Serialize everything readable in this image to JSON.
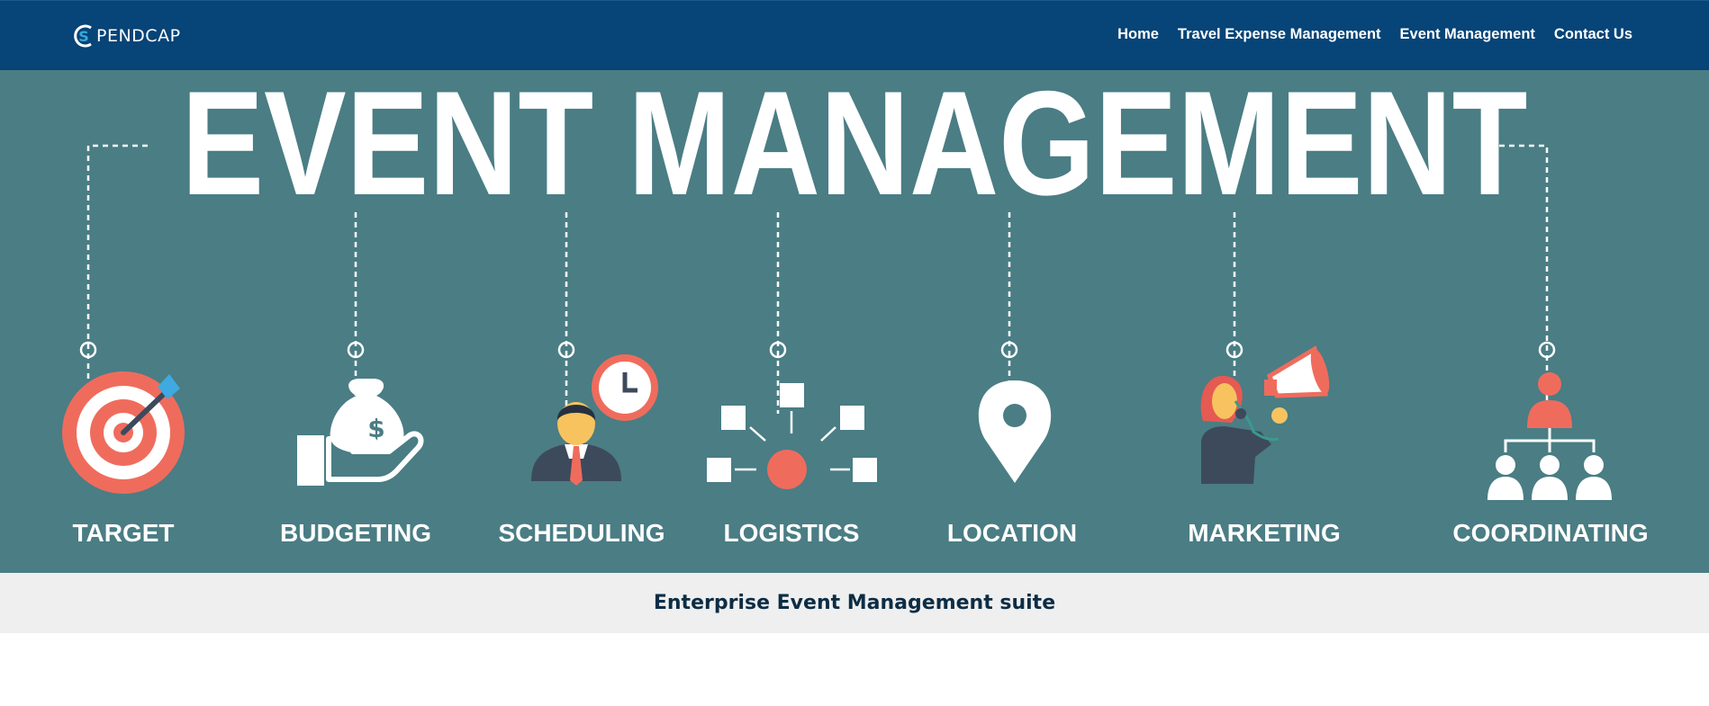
{
  "brand": {
    "logo_text": "PENDCAP",
    "logo_letter": "S"
  },
  "nav": {
    "items": [
      {
        "label": "Home"
      },
      {
        "label": "Travel Expense Management"
      },
      {
        "label": "Event Management"
      },
      {
        "label": "Contact Us"
      }
    ]
  },
  "hero": {
    "title": "EVENT MANAGEMENT",
    "features": [
      {
        "label": "TARGET",
        "icon": "target-icon"
      },
      {
        "label": "BUDGETING",
        "icon": "money-bag-hand-icon"
      },
      {
        "label": "SCHEDULING",
        "icon": "businessman-clock-icon"
      },
      {
        "label": "LOGISTICS",
        "icon": "network-nodes-icon"
      },
      {
        "label": "LOCATION",
        "icon": "map-pin-icon"
      },
      {
        "label": "MARKETING",
        "icon": "megaphone-woman-icon"
      },
      {
        "label": "COORDINATING",
        "icon": "org-chart-icon"
      }
    ]
  },
  "subtitle": "Enterprise Event Management suite",
  "colors": {
    "nav_bg": "#074477",
    "hero_bg": "#4a7d84",
    "accent": "#ef6c5d",
    "subbar_bg": "#efefef",
    "subtitle_text": "#0d2d45"
  }
}
